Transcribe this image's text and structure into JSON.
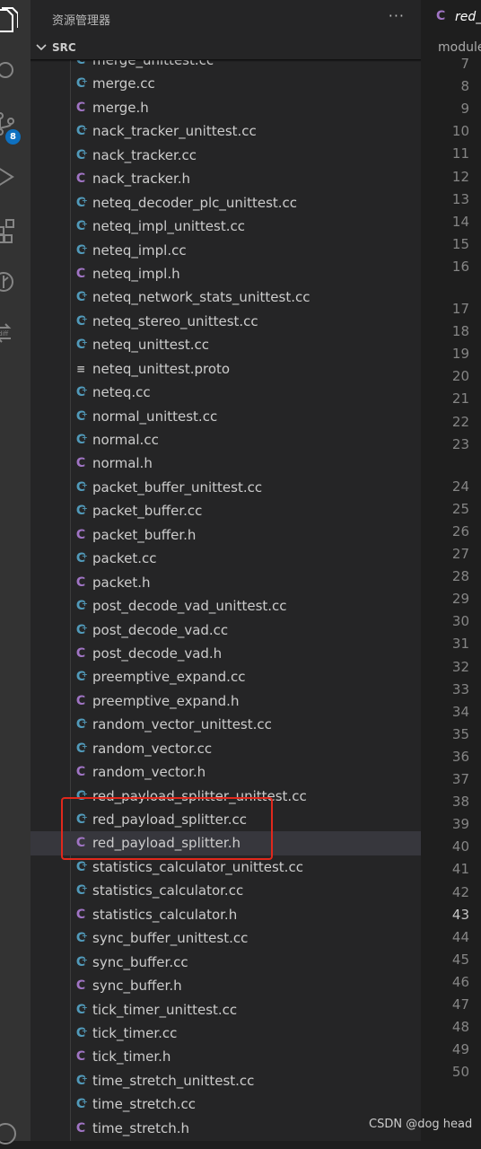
{
  "explorer": {
    "title": "资源管理器",
    "more": "···",
    "section": "SRC"
  },
  "activity_bar": {
    "icons": [
      "files-icon",
      "search-icon",
      "source-control-icon",
      "run-debug-icon",
      "extensions-icon",
      "git-graph-icon",
      "remote-icon",
      "account-icon"
    ],
    "scm_badge": "8"
  },
  "files": [
    {
      "name": "merge_unittest.cc",
      "type": "cc"
    },
    {
      "name": "merge.cc",
      "type": "cc"
    },
    {
      "name": "merge.h",
      "type": "h"
    },
    {
      "name": "nack_tracker_unittest.cc",
      "type": "cc"
    },
    {
      "name": "nack_tracker.cc",
      "type": "cc"
    },
    {
      "name": "nack_tracker.h",
      "type": "h"
    },
    {
      "name": "neteq_decoder_plc_unittest.cc",
      "type": "cc"
    },
    {
      "name": "neteq_impl_unittest.cc",
      "type": "cc"
    },
    {
      "name": "neteq_impl.cc",
      "type": "cc"
    },
    {
      "name": "neteq_impl.h",
      "type": "h"
    },
    {
      "name": "neteq_network_stats_unittest.cc",
      "type": "cc"
    },
    {
      "name": "neteq_stereo_unittest.cc",
      "type": "cc"
    },
    {
      "name": "neteq_unittest.cc",
      "type": "cc"
    },
    {
      "name": "neteq_unittest.proto",
      "type": "proto"
    },
    {
      "name": "neteq.cc",
      "type": "cc"
    },
    {
      "name": "normal_unittest.cc",
      "type": "cc"
    },
    {
      "name": "normal.cc",
      "type": "cc"
    },
    {
      "name": "normal.h",
      "type": "h"
    },
    {
      "name": "packet_buffer_unittest.cc",
      "type": "cc"
    },
    {
      "name": "packet_buffer.cc",
      "type": "cc"
    },
    {
      "name": "packet_buffer.h",
      "type": "h"
    },
    {
      "name": "packet.cc",
      "type": "cc"
    },
    {
      "name": "packet.h",
      "type": "h"
    },
    {
      "name": "post_decode_vad_unittest.cc",
      "type": "cc"
    },
    {
      "name": "post_decode_vad.cc",
      "type": "cc"
    },
    {
      "name": "post_decode_vad.h",
      "type": "h"
    },
    {
      "name": "preemptive_expand.cc",
      "type": "cc"
    },
    {
      "name": "preemptive_expand.h",
      "type": "h"
    },
    {
      "name": "random_vector_unittest.cc",
      "type": "cc"
    },
    {
      "name": "random_vector.cc",
      "type": "cc"
    },
    {
      "name": "random_vector.h",
      "type": "h"
    },
    {
      "name": "red_payload_splitter_unittest.cc",
      "type": "cc"
    },
    {
      "name": "red_payload_splitter.cc",
      "type": "cc"
    },
    {
      "name": "red_payload_splitter.h",
      "type": "h",
      "selected": true
    },
    {
      "name": "statistics_calculator_unittest.cc",
      "type": "cc"
    },
    {
      "name": "statistics_calculator.cc",
      "type": "cc"
    },
    {
      "name": "statistics_calculator.h",
      "type": "h"
    },
    {
      "name": "sync_buffer_unittest.cc",
      "type": "cc"
    },
    {
      "name": "sync_buffer.cc",
      "type": "cc"
    },
    {
      "name": "sync_buffer.h",
      "type": "h"
    },
    {
      "name": "tick_timer_unittest.cc",
      "type": "cc"
    },
    {
      "name": "tick_timer.cc",
      "type": "cc"
    },
    {
      "name": "tick_timer.h",
      "type": "h"
    },
    {
      "name": "time_stretch_unittest.cc",
      "type": "cc"
    },
    {
      "name": "time_stretch.cc",
      "type": "cc"
    },
    {
      "name": "time_stretch.h",
      "type": "h"
    }
  ],
  "editor": {
    "tab_icon": "C",
    "tab_label": "red_",
    "breadcrumb": "module",
    "line_numbers": [
      "7",
      "8",
      "9",
      "10",
      "11",
      "12",
      "13",
      "14",
      "15",
      "16",
      "17",
      "18",
      "19",
      "20",
      "21",
      "22",
      "23",
      "24",
      "25",
      "26",
      "27",
      "28",
      "29",
      "30",
      "31",
      "32",
      "33",
      "34",
      "35",
      "36",
      "37",
      "38",
      "39",
      "40",
      "41",
      "42",
      "43",
      "44",
      "45",
      "46",
      "47",
      "48",
      "49",
      "50"
    ],
    "active_line": "43"
  },
  "watermark": "CSDN @dog head"
}
